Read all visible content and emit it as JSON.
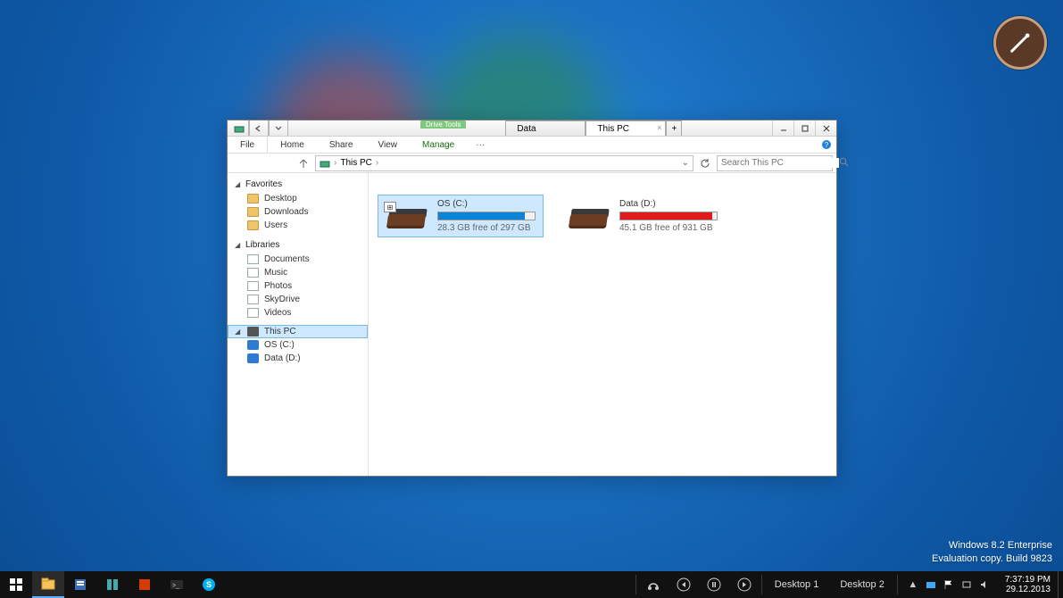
{
  "desktop": {
    "watermark_line1": "Windows 8.2 Enterprise",
    "watermark_line2": "Evaluation copy. Build 9823",
    "brush_icon": "brush-icon"
  },
  "window": {
    "context_tool_label": "Drive Tools",
    "tabs": [
      {
        "label": "Data",
        "active": false
      },
      {
        "label": "This PC",
        "active": true
      }
    ],
    "ribbon": {
      "file": "File",
      "home": "Home",
      "share": "Share",
      "view": "View",
      "manage": "Manage"
    },
    "address": {
      "location": "This PC",
      "search_placeholder": "Search This PC"
    },
    "nav": {
      "favorites_label": "Favorites",
      "favorites": [
        "Desktop",
        "Downloads",
        "Users"
      ],
      "libraries_label": "Libraries",
      "libraries": [
        "Documents",
        "Music",
        "Photos",
        "SkyDrive",
        "Videos"
      ],
      "this_pc_label": "This PC",
      "this_pc_children": [
        "OS (C:)",
        "Data (D:)"
      ]
    },
    "drives": [
      {
        "name": "OS (C:)",
        "free_text": "28.3 GB free of 297 GB",
        "fill_pct": 90,
        "color": "blue",
        "selected": true,
        "has_os_badge": true
      },
      {
        "name": "Data (D:)",
        "free_text": "45.1 GB free of 931 GB",
        "fill_pct": 95,
        "color": "red",
        "selected": false,
        "has_os_badge": false
      }
    ]
  },
  "taskbar": {
    "desktop1": "Desktop 1",
    "desktop2": "Desktop 2",
    "time": "7:37:19 PM",
    "date": "29.12.2013"
  }
}
